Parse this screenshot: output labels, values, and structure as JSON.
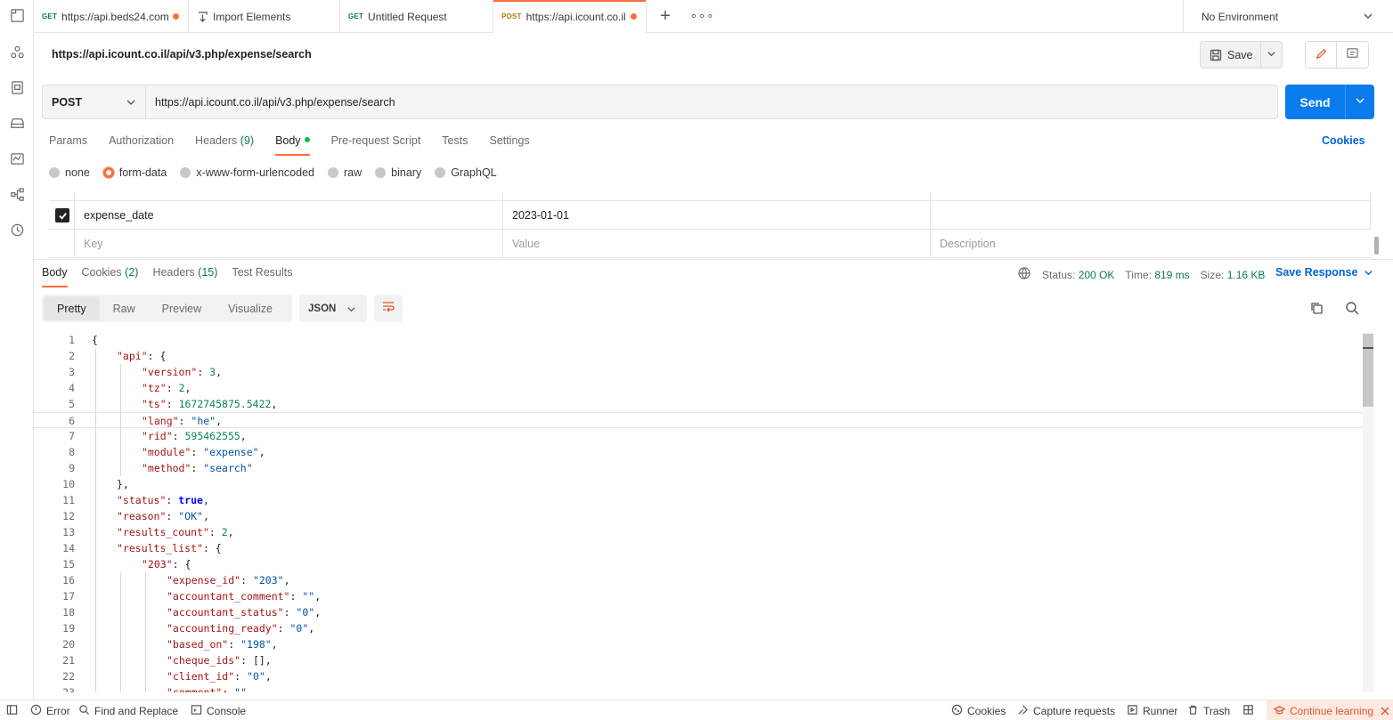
{
  "tabs": [
    {
      "method": "GET",
      "title": "https://api.beds24.com",
      "dot": true
    },
    {
      "method": "",
      "title": "Import Elements",
      "dot": false
    },
    {
      "method": "GET",
      "title": "Untitled Request",
      "dot": false
    },
    {
      "method": "POST",
      "title": "https://api.icount.co.il",
      "dot": true
    }
  ],
  "environment": "No Environment",
  "request": {
    "name": "https://api.icount.co.il/api/v3.php/expense/search",
    "method": "POST",
    "url": "https://api.icount.co.il/api/v3.php/expense/search",
    "save_label": "Save",
    "send_label": "Send"
  },
  "request_tabs": {
    "params": "Params",
    "authorization": "Authorization",
    "headers": "Headers",
    "headers_count": "(9)",
    "body": "Body",
    "prerequest": "Pre-request Script",
    "tests": "Tests",
    "settings": "Settings",
    "cookies": "Cookies"
  },
  "body_types": {
    "none": "none",
    "form_data": "form-data",
    "urlencoded": "x-www-form-urlencoded",
    "raw": "raw",
    "binary": "binary",
    "graphql": "GraphQL"
  },
  "form": {
    "row": {
      "key": "expense_date",
      "value": "2023-01-01"
    },
    "placeholders": {
      "key": "Key",
      "value": "Value",
      "description": "Description"
    }
  },
  "response_tabs": {
    "body": "Body",
    "cookies": "Cookies",
    "cookies_count": "(2)",
    "headers": "Headers",
    "headers_count": "(15)",
    "test_results": "Test Results"
  },
  "response_meta": {
    "status_label": "Status:",
    "status_value": "200 OK",
    "time_label": "Time:",
    "time_value": "819 ms",
    "size_label": "Size:",
    "size_value": "1.16 KB",
    "save_response": "Save Response"
  },
  "format": {
    "pretty": "Pretty",
    "raw": "Raw",
    "preview": "Preview",
    "visualize": "Visualize",
    "language": "JSON"
  },
  "code_lines": [
    {
      "n": "1",
      "d": 0,
      "p": [
        [
          "p",
          "{"
        ]
      ]
    },
    {
      "n": "2",
      "d": 1,
      "p": [
        [
          "k",
          "\"api\""
        ],
        [
          "p",
          ": {"
        ]
      ]
    },
    {
      "n": "3",
      "d": 2,
      "p": [
        [
          "k",
          "\"version\""
        ],
        [
          "p",
          ": "
        ],
        [
          "n",
          "3"
        ],
        [
          "p",
          ","
        ]
      ]
    },
    {
      "n": "4",
      "d": 2,
      "p": [
        [
          "k",
          "\"tz\""
        ],
        [
          "p",
          ": "
        ],
        [
          "n",
          "2"
        ],
        [
          "p",
          ","
        ]
      ]
    },
    {
      "n": "5",
      "d": 2,
      "p": [
        [
          "k",
          "\"ts\""
        ],
        [
          "p",
          ": "
        ],
        [
          "n",
          "1672745875.5422"
        ],
        [
          "p",
          ","
        ]
      ]
    },
    {
      "n": "6",
      "d": 2,
      "p": [
        [
          "k",
          "\"lang\""
        ],
        [
          "p",
          ": "
        ],
        [
          "s",
          "\"he\""
        ],
        [
          "p",
          ","
        ]
      ]
    },
    {
      "n": "7",
      "d": 2,
      "p": [
        [
          "k",
          "\"rid\""
        ],
        [
          "p",
          ": "
        ],
        [
          "n",
          "595462555"
        ],
        [
          "p",
          ","
        ]
      ]
    },
    {
      "n": "8",
      "d": 2,
      "p": [
        [
          "k",
          "\"module\""
        ],
        [
          "p",
          ": "
        ],
        [
          "s",
          "\"expense\""
        ],
        [
          "p",
          ","
        ]
      ]
    },
    {
      "n": "9",
      "d": 2,
      "p": [
        [
          "k",
          "\"method\""
        ],
        [
          "p",
          ": "
        ],
        [
          "s",
          "\"search\""
        ]
      ]
    },
    {
      "n": "10",
      "d": 1,
      "p": [
        [
          "p",
          "},"
        ]
      ]
    },
    {
      "n": "11",
      "d": 1,
      "p": [
        [
          "k",
          "\"status\""
        ],
        [
          "p",
          ": "
        ],
        [
          "b",
          "true"
        ],
        [
          "p",
          ","
        ]
      ]
    },
    {
      "n": "12",
      "d": 1,
      "p": [
        [
          "k",
          "\"reason\""
        ],
        [
          "p",
          ": "
        ],
        [
          "s",
          "\"OK\""
        ],
        [
          "p",
          ","
        ]
      ]
    },
    {
      "n": "13",
      "d": 1,
      "p": [
        [
          "k",
          "\"results_count\""
        ],
        [
          "p",
          ": "
        ],
        [
          "n",
          "2"
        ],
        [
          "p",
          ","
        ]
      ]
    },
    {
      "n": "14",
      "d": 1,
      "p": [
        [
          "k",
          "\"results_list\""
        ],
        [
          "p",
          ": {"
        ]
      ]
    },
    {
      "n": "15",
      "d": 2,
      "p": [
        [
          "k",
          "\"203\""
        ],
        [
          "p",
          ": {"
        ]
      ]
    },
    {
      "n": "16",
      "d": 3,
      "p": [
        [
          "k",
          "\"expense_id\""
        ],
        [
          "p",
          ": "
        ],
        [
          "s",
          "\"203\""
        ],
        [
          "p",
          ","
        ]
      ]
    },
    {
      "n": "17",
      "d": 3,
      "p": [
        [
          "k",
          "\"accountant_comment\""
        ],
        [
          "p",
          ": "
        ],
        [
          "s",
          "\"\""
        ],
        [
          "p",
          ","
        ]
      ]
    },
    {
      "n": "18",
      "d": 3,
      "p": [
        [
          "k",
          "\"accountant_status\""
        ],
        [
          "p",
          ": "
        ],
        [
          "s",
          "\"0\""
        ],
        [
          "p",
          ","
        ]
      ]
    },
    {
      "n": "19",
      "d": 3,
      "p": [
        [
          "k",
          "\"accounting_ready\""
        ],
        [
          "p",
          ": "
        ],
        [
          "s",
          "\"0\""
        ],
        [
          "p",
          ","
        ]
      ]
    },
    {
      "n": "20",
      "d": 3,
      "p": [
        [
          "k",
          "\"based_on\""
        ],
        [
          "p",
          ": "
        ],
        [
          "s",
          "\"198\""
        ],
        [
          "p",
          ","
        ]
      ]
    },
    {
      "n": "21",
      "d": 3,
      "p": [
        [
          "k",
          "\"cheque_ids\""
        ],
        [
          "p",
          ": [],"
        ]
      ]
    },
    {
      "n": "22",
      "d": 3,
      "p": [
        [
          "k",
          "\"client_id\""
        ],
        [
          "p",
          ": "
        ],
        [
          "s",
          "\"0\""
        ],
        [
          "p",
          ","
        ]
      ]
    },
    {
      "n": "23",
      "d": 3,
      "p": [
        [
          "k",
          "\"comment\""
        ],
        [
          "p",
          ": "
        ],
        [
          "s",
          "\"\""
        ]
      ]
    }
  ],
  "statusbar": {
    "error": "Error",
    "find_replace": "Find and Replace",
    "console": "Console",
    "cookies": "Cookies",
    "capture": "Capture requests",
    "runner": "Runner",
    "trash": "Trash",
    "continue_learning": "Continue learning"
  },
  "colors": {
    "accent": "#ff6c37",
    "send": "#097bed",
    "link": "#0265d2",
    "success": "#0c7b4a"
  }
}
